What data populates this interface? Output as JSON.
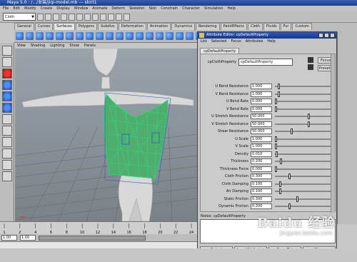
{
  "window": {
    "title": "Maya 5.0 : /.../女装/jiqi-model.mb --- skirt1"
  },
  "menubar": {
    "items": [
      "File",
      "Edit",
      "Modify",
      "Create",
      "Display",
      "Window",
      "Animate",
      "Deform",
      "Skeleton",
      "Skin",
      "Constrain",
      "Character",
      "Simulation",
      "Help"
    ]
  },
  "statusline": {
    "mode": "Cloth"
  },
  "shelf": {
    "tabs": [
      "General",
      "Curves",
      "Surfaces",
      "Polygons",
      "Subdivs",
      "Deformation",
      "Animation",
      "Dynamics",
      "Rendering",
      "PaintEffects",
      "Cloth",
      "Fluids",
      "Fur",
      "Custom"
    ],
    "active_tab": "Surfaces",
    "icon_count": 20
  },
  "viewport": {
    "menu": [
      "View",
      "Shading",
      "Lighting",
      "Show",
      "Panels"
    ]
  },
  "attribute_editor": {
    "title": "Attribute Editor: cpDefaultProperty",
    "menu": [
      "List",
      "Selected",
      "Focus",
      "Attributes",
      "Help"
    ],
    "tab": "cpDefaultProperty",
    "node_label": "cpClothProperty",
    "node_value": "cpDefaultProperty",
    "focus_button": "Focus",
    "presets_button": "Presets",
    "attributes": [
      {
        "label": "U Bend Resistance",
        "value": "1.000",
        "slider": 0.05
      },
      {
        "label": "V Bend Resistance",
        "value": "1.000",
        "slider": 0.05
      },
      {
        "label": "U Bend Rate",
        "value": "0.000",
        "slider": 0.0
      },
      {
        "label": "V Bend Rate",
        "value": "0.000",
        "slider": 0.0
      },
      {
        "label": "U Stretch Resistance",
        "value": "50.000",
        "slider": 0.62
      },
      {
        "label": "V Stretch Resistance",
        "value": "50.000",
        "slider": 0.62
      },
      {
        "label": "Shear Resistance",
        "value": "50.000",
        "slider": 0.3
      },
      {
        "label": "U Scale",
        "value": "1.000",
        "slider": 0.0
      },
      {
        "label": "V Scale",
        "value": "1.000",
        "slider": 0.0
      },
      {
        "label": "Density",
        "value": "0.010",
        "slider": 0.02
      },
      {
        "label": "Thickness",
        "value": "0.200",
        "slider": 0.1
      },
      {
        "label": "Thickness Force",
        "value": "0.000",
        "slider": 0.0
      },
      {
        "label": "Cloth Friction",
        "value": "0.300",
        "slider": 0.25
      },
      {
        "label": "Cloth Damping",
        "value": "0.100",
        "slider": 0.08
      },
      {
        "label": "Air Damping",
        "value": "0.100",
        "slider": 0.08
      },
      {
        "label": "Static Friction",
        "value": "0.300",
        "slider": 0.4
      },
      {
        "label": "Dynamic Friction",
        "value": "0.200",
        "slider": 0.25
      }
    ],
    "notes_label": "Notes: cpDefaultProperty",
    "buttons": [
      "Select",
      "Load Attributes",
      "Copy Tab",
      "Close"
    ]
  },
  "timeline": {
    "ticks": [
      "1",
      "2",
      "4",
      "6",
      "8",
      "10",
      "12",
      "14",
      "16",
      "18",
      "20",
      "22",
      "24"
    ]
  },
  "range": {
    "start": "1.00",
    "current": "1.00"
  },
  "watermark": {
    "text": "Baidu 经验",
    "sub": "jingyan.baidu.com"
  }
}
